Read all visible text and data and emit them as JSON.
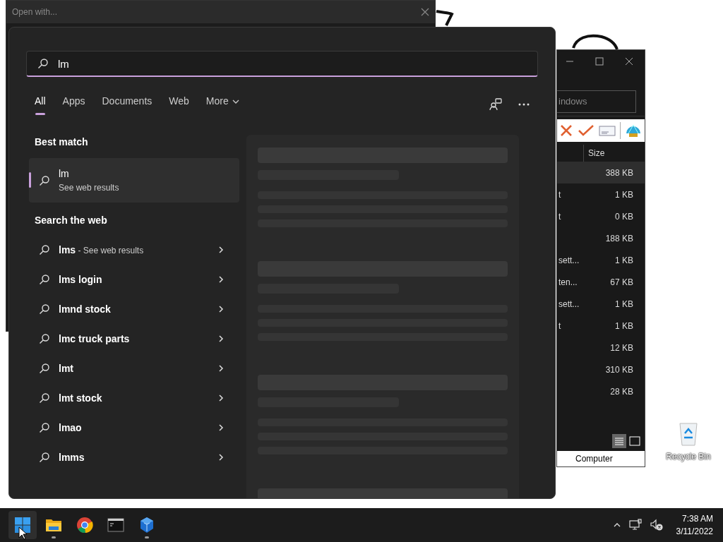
{
  "background_window": {
    "title": "Open with..."
  },
  "explorer_window": {
    "address": "indows",
    "column": "Size",
    "rows": [
      {
        "name": "",
        "size": "388 KB",
        "selected": true
      },
      {
        "name": "t",
        "size": "1 KB",
        "selected": false
      },
      {
        "name": "t",
        "size": "0 KB",
        "selected": false
      },
      {
        "name": "",
        "size": "188 KB",
        "selected": false
      },
      {
        "name": "sett...",
        "size": "1 KB",
        "selected": false
      },
      {
        "name": "ten...",
        "size": "67 KB",
        "selected": false
      },
      {
        "name": "sett...",
        "size": "1 KB",
        "selected": false
      },
      {
        "name": "t",
        "size": "1 KB",
        "selected": false
      },
      {
        "name": "",
        "size": "12 KB",
        "selected": false
      },
      {
        "name": "",
        "size": "310 KB",
        "selected": false
      },
      {
        "name": "",
        "size": "28 KB",
        "selected": false
      }
    ],
    "status": "Computer"
  },
  "search": {
    "value": "lm",
    "tabs": [
      {
        "label": "All",
        "selected": true
      },
      {
        "label": "Apps",
        "selected": false
      },
      {
        "label": "Documents",
        "selected": false
      },
      {
        "label": "Web",
        "selected": false
      },
      {
        "label": "More",
        "selected": false,
        "dropdown": true
      }
    ],
    "best_match_heading": "Best match",
    "best_match": {
      "title": "lm",
      "subtitle": "See web results",
      "selected": true
    },
    "web_heading": "Search the web",
    "web_results": [
      {
        "text": "lms",
        "suffix": "- See web results"
      },
      {
        "text": "lms login"
      },
      {
        "text": "lmnd stock"
      },
      {
        "text": "lmc truck parts"
      },
      {
        "text": "lmt"
      },
      {
        "text": "lmt stock"
      },
      {
        "text": "lmao"
      },
      {
        "text": "lmms"
      }
    ]
  },
  "desktop_icons": [
    {
      "label": "Recycle Bin"
    }
  ],
  "taskbar": {
    "apps": [
      {
        "kind": "start",
        "selected": true,
        "running": false
      },
      {
        "kind": "folder",
        "selected": false,
        "running": true
      },
      {
        "kind": "browser",
        "selected": false,
        "running": false
      },
      {
        "kind": "terminal",
        "selected": false,
        "running": false
      },
      {
        "kind": "cube",
        "selected": false,
        "running": true
      }
    ],
    "time": "7:38 AM",
    "date": "3/11/2022"
  }
}
